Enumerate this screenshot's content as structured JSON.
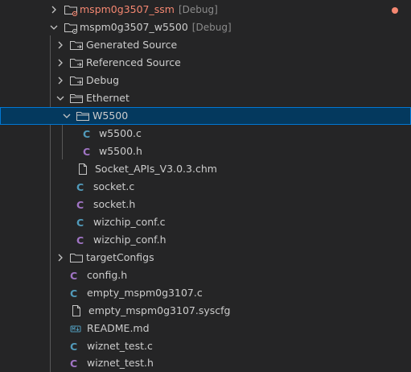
{
  "colors": {
    "background": "#252526",
    "selection_bg": "#04395e",
    "selection_border": "#0078d4",
    "text": "#cccccc",
    "description": "#8b8b8b",
    "error_text": "#f48771",
    "c_file_icon": "#519aba",
    "h_file_icon": "#a074c4"
  },
  "explorer": {
    "items": [
      {
        "label": "mspm0g3507_ssm",
        "description": "[Debug]",
        "type": "project",
        "expanded": false,
        "has_error": true
      },
      {
        "label": "mspm0g3507_w5500",
        "description": "[Debug]",
        "type": "project",
        "expanded": true
      },
      {
        "label": "Generated Source",
        "type": "folder-link",
        "expanded": false
      },
      {
        "label": "Referenced Source",
        "type": "folder-link",
        "expanded": false
      },
      {
        "label": "Debug",
        "type": "folder-link",
        "expanded": false
      },
      {
        "label": "Ethernet",
        "type": "folder",
        "expanded": true
      },
      {
        "label": "W5500",
        "type": "folder",
        "expanded": true,
        "selected": true
      },
      {
        "label": "w5500.c",
        "type": "c-file"
      },
      {
        "label": "w5500.h",
        "type": "h-file"
      },
      {
        "label": "Socket_APIs_V3.0.3.chm",
        "type": "file"
      },
      {
        "label": "socket.c",
        "type": "c-file"
      },
      {
        "label": "socket.h",
        "type": "h-file"
      },
      {
        "label": "wizchip_conf.c",
        "type": "c-file"
      },
      {
        "label": "wizchip_conf.h",
        "type": "h-file"
      },
      {
        "label": "targetConfigs",
        "type": "folder",
        "expanded": false
      },
      {
        "label": "config.h",
        "type": "h-file"
      },
      {
        "label": "empty_mspm0g3107.c",
        "type": "c-file"
      },
      {
        "label": "empty_mspm0g3107.syscfg",
        "type": "file"
      },
      {
        "label": "README.md",
        "type": "markdown-file"
      },
      {
        "label": "wiznet_test.c",
        "type": "c-file"
      },
      {
        "label": "wiznet_test.h",
        "type": "h-file"
      }
    ]
  }
}
